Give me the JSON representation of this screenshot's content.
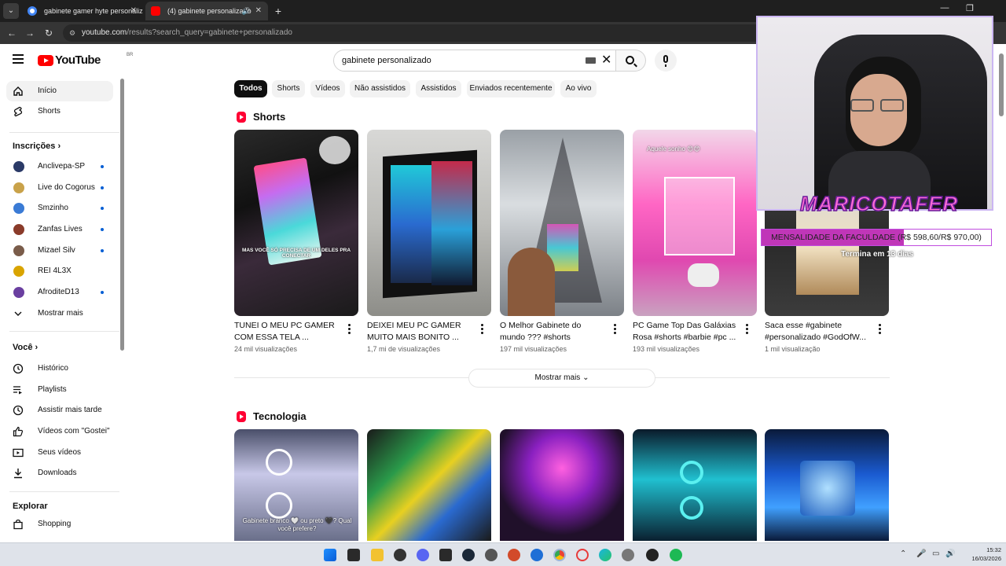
{
  "browser": {
    "tabs": [
      {
        "title": "gabinete gamer hyte personaliz",
        "favicon_color": "#4285f4"
      },
      {
        "title": "(4) gabinete personalizado",
        "favicon_color": "#ff0000",
        "active": true
      }
    ],
    "url_host": "youtube.com",
    "url_path": "/results?search_query=gabinete+personalizado"
  },
  "youtube": {
    "logo": "YouTube",
    "country_code": "BR",
    "search_value": "gabinete personalizado"
  },
  "sidebar": {
    "main": [
      {
        "label": "Início",
        "icon": "home-icon"
      },
      {
        "label": "Shorts",
        "icon": "shorts-icon"
      }
    ],
    "subscriptions_title": "Inscrições",
    "subscriptions": [
      {
        "label": "Anclivepa-SP",
        "color": "#2b3a67"
      },
      {
        "label": "Live do Cogorus",
        "color": "#c9a24a"
      },
      {
        "label": "Smzinho",
        "color": "#3a7bd5"
      },
      {
        "label": "Zanfas Lives",
        "color": "#8a3b2a"
      },
      {
        "label": "Mizael Silv",
        "color": "#7a5c4a"
      },
      {
        "label": "REI 4L3X",
        "color": "#d9a400"
      },
      {
        "label": "AfroditeD13",
        "color": "#6a3fa0"
      }
    ],
    "show_more": "Mostrar mais",
    "you_title": "Você",
    "you_items": [
      {
        "label": "Histórico",
        "icon": "history-icon"
      },
      {
        "label": "Playlists",
        "icon": "playlists-icon"
      },
      {
        "label": "Assistir mais tarde",
        "icon": "watch-later-icon"
      },
      {
        "label": "Vídeos com \"Gostei\"",
        "icon": "thumbs-up-icon"
      },
      {
        "label": "Seus vídeos",
        "icon": "your-videos-icon"
      },
      {
        "label": "Downloads",
        "icon": "download-icon"
      }
    ],
    "explore_title": "Explorar",
    "explore_items": [
      {
        "label": "Shopping",
        "icon": "shopping-icon"
      }
    ]
  },
  "chips": [
    "Todos",
    "Shorts",
    "Vídeos",
    "Não assistidos",
    "Assistidos",
    "Enviados recentemente",
    "Ao vivo"
  ],
  "shorts_shelf": {
    "title": "Shorts",
    "items": [
      {
        "title": "TUNEI O MEU PC GAMER\nCOM ESSA TELA ...",
        "views": "24 mil visualizações",
        "caption": "MAS VOCÊ SÓ PRECISA DE UM DELES PRA CONECTAR"
      },
      {
        "title": "DEIXEI MEU PC GAMER\nMUITO MAIS BONITO ...",
        "views": "1,7 mi de visualizações",
        "caption": ""
      },
      {
        "title": "O Melhor Gabinete do\nmundo ??? #shorts",
        "views": "197 mil visualizações",
        "caption": ""
      },
      {
        "title": "PC Game Top Das Galáxias\nRosa #shorts #barbie #pc ...",
        "views": "193 mil visualizações",
        "caption": "Aquele sonho 😍😍"
      },
      {
        "title": "Saca esse #gabinete\n#personalizado #GodOfW...",
        "views": "1 mil visualização",
        "caption": ""
      }
    ],
    "show_more": "Mostrar mais"
  },
  "tech_shelf": {
    "title": "Tecnologia",
    "captions": [
      "Gabinete branco 🤍 ou preto 🖤? Qual você prefere?",
      "",
      "",
      "",
      ""
    ]
  },
  "stream_overlay": {
    "name": "MARICOTAFER",
    "goal_text": "MENSALIDADE DA FACULDADE (R$ 598,60/R$ 970,00)",
    "goal_progress": 0.62,
    "goal_sub": "Termina em 13 dias"
  },
  "taskbar": {
    "time": "15:32",
    "date": "16/03/2026"
  }
}
